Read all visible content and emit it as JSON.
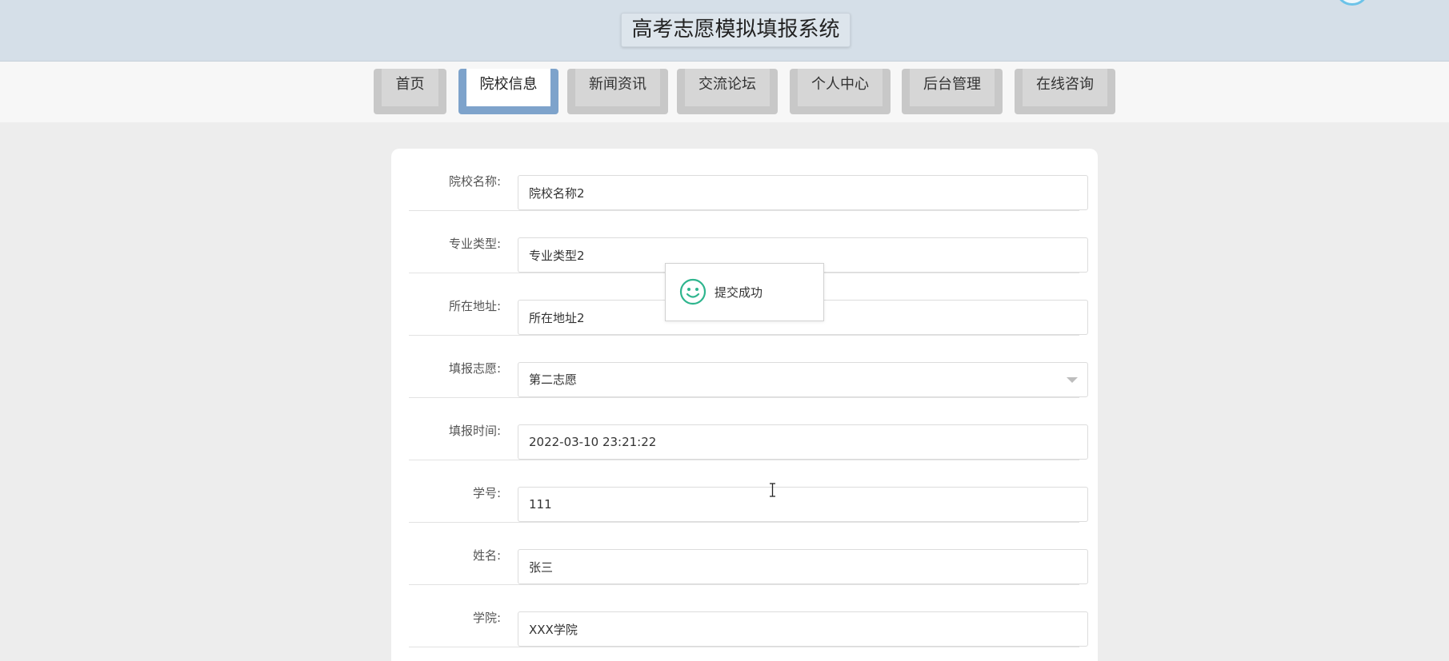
{
  "header": {
    "title": "高考志愿模拟填报系统"
  },
  "nav": {
    "items": [
      {
        "label": "首页"
      },
      {
        "label": "院校信息"
      },
      {
        "label": "新闻资讯"
      },
      {
        "label": "交流论坛"
      },
      {
        "label": "个人中心"
      },
      {
        "label": "后台管理"
      },
      {
        "label": "在线咨询"
      }
    ],
    "active": "院校信息"
  },
  "form": {
    "fields": [
      {
        "label": "院校名称:",
        "value": "院校名称2"
      },
      {
        "label": "专业类型:",
        "value": "专业类型2"
      },
      {
        "label": "所在地址:",
        "value": "所在地址2"
      },
      {
        "label": "填报志愿:",
        "value": "第二志愿"
      },
      {
        "label": "填报时间:",
        "value": "2022-03-10 23:21:22"
      },
      {
        "label": "学号:",
        "value": "111"
      },
      {
        "label": "姓名:",
        "value": "张三"
      },
      {
        "label": "学院:",
        "value": "XXX学院"
      }
    ]
  },
  "toast": {
    "message": "提交成功",
    "icon": "smile-icon",
    "color": "#2fb58e"
  },
  "colors": {
    "header_bg": "#d5dfe8",
    "nav_active": "#7ea3cb",
    "page_bg": "#ededed"
  }
}
